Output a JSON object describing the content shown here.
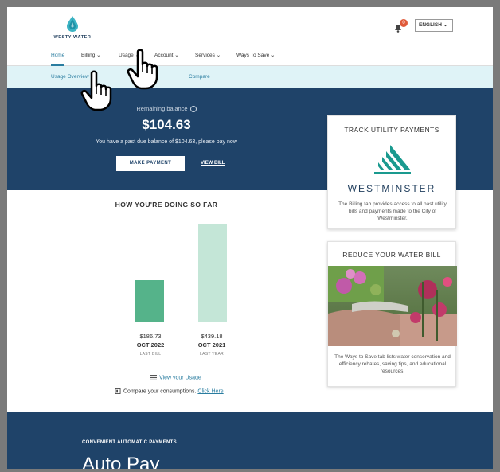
{
  "header": {
    "logo_text": "WESTY WATER",
    "notification_count": "0",
    "language": "ENGLISH"
  },
  "nav": {
    "items": [
      "Home",
      "Billing",
      "Usage",
      "Account",
      "Services",
      "Ways To Save"
    ],
    "active": "Home"
  },
  "subnav": {
    "items": [
      "Usage Overview",
      "Compare"
    ]
  },
  "hero": {
    "label": "Remaining balance",
    "balance": "$104.63",
    "message": "You have a past due balance of $104.63, please pay now",
    "pay_button": "MAKE PAYMENT",
    "view_bill": "VIEW BILL"
  },
  "usage": {
    "title": "HOW YOU'RE DOING SO FAR",
    "view_link": "View your Usage",
    "compare_text": "Compare your consumptions.",
    "compare_link": "Click Here"
  },
  "chart_data": {
    "type": "bar",
    "title": "HOW YOU'RE DOING SO FAR",
    "categories": [
      "OCT 2022",
      "OCT 2021"
    ],
    "values": [
      186.73,
      439.18
    ],
    "value_labels": [
      "$186.73",
      "$439.18"
    ],
    "captions": [
      "LAST BILL",
      "LAST YEAR"
    ],
    "colors": [
      "#55b38a",
      "#c4e6d7"
    ],
    "ylim": [
      0,
      439.18
    ],
    "grid": false
  },
  "cards": {
    "track": {
      "title": "TRACK UTILITY PAYMENTS",
      "org": "WESTMINSTER",
      "text": "The Billing tab provides access to all past utility bills and payments made to the City of Westminster."
    },
    "reduce": {
      "title": "REDUCE YOUR WATER BILL",
      "text": "The Ways to Save tab lists water conservation and efficiency rebates, saving tips, and educational resources."
    }
  },
  "bottom": {
    "label": "CONVENIENT AUTOMATIC PAYMENTS",
    "title": "Auto Pay"
  },
  "colors": {
    "navy": "#1f4369",
    "accent": "#2a7da0",
    "subnav_bg": "#dff3f7",
    "teal_logo": "#1a9a8f"
  }
}
